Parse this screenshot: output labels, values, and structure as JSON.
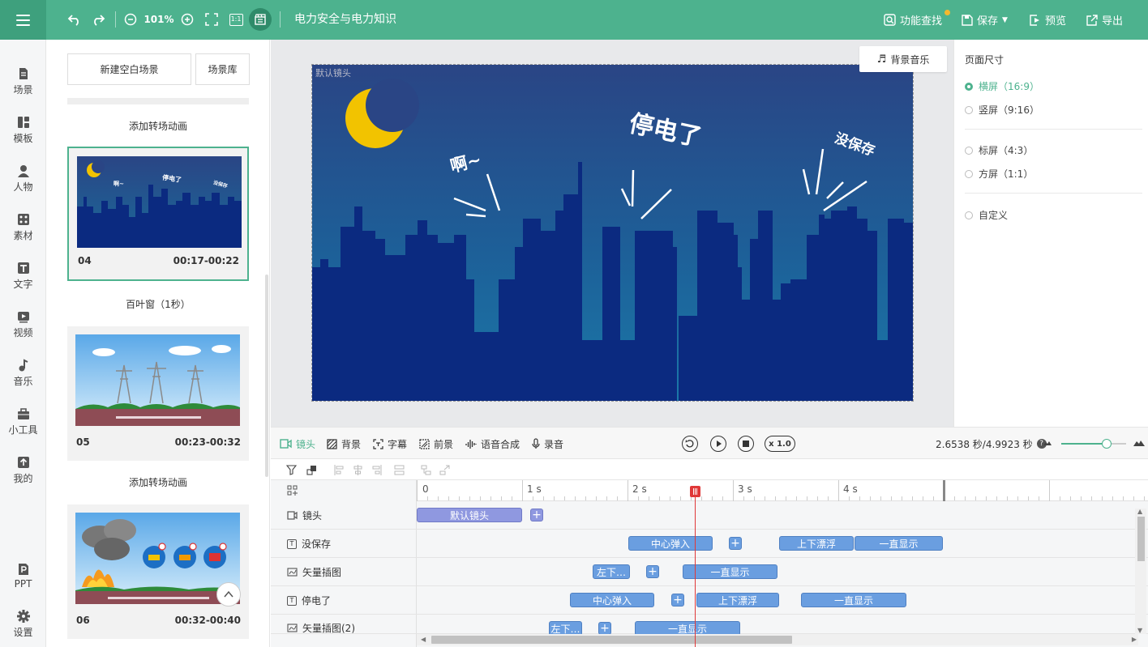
{
  "header": {
    "title": "电力安全与电力知识",
    "zoom": "101%",
    "ratio_btn": "1:1",
    "find_label": "功能查找",
    "save_label": "保存",
    "preview_label": "预览",
    "export_label": "导出"
  },
  "leftnav": {
    "items": [
      {
        "label": "场景"
      },
      {
        "label": "模板"
      },
      {
        "label": "人物"
      },
      {
        "label": "素材"
      },
      {
        "label": "文字"
      },
      {
        "label": "视频"
      },
      {
        "label": "音乐"
      },
      {
        "label": "小工具"
      },
      {
        "label": "我的"
      },
      {
        "label": "PPT"
      },
      {
        "label": "设置"
      }
    ]
  },
  "scenes": {
    "new_blank": "新建空白场景",
    "library": "场景库",
    "transitions": [
      "添加转场动画",
      "百叶窗（1秒）",
      "添加转场动画"
    ],
    "cards": [
      {
        "num": "04",
        "time": "00:17-00:22"
      },
      {
        "num": "05",
        "time": "00:23-00:32"
      },
      {
        "num": "06",
        "time": "00:32-00:40"
      }
    ]
  },
  "stage": {
    "default_lens": "默认镜头",
    "bgm_label": "背景音乐",
    "text_a": "啊~",
    "text_b": "停电了",
    "text_c": "没保存"
  },
  "page_size": {
    "heading": "页面尺寸",
    "options": [
      {
        "label": "横屏（16:9）",
        "selected": true
      },
      {
        "label": "竖屏（9:16）",
        "selected": false
      },
      {
        "label": "标屏（4:3）",
        "selected": false
      },
      {
        "label": "方屏（1:1）",
        "selected": false
      },
      {
        "label": "自定义",
        "selected": false
      }
    ]
  },
  "toolbar": {
    "tabs": [
      "镜头",
      "背景",
      "字幕",
      "前景",
      "语音合成",
      "录音"
    ],
    "speed": "x 1.0",
    "time": "2.6538 秒/4.9923 秒",
    "zoom_fraction": 0.7
  },
  "timeline": {
    "ruler": [
      "0",
      "1 s",
      "2 s",
      "3 s",
      "4 s"
    ],
    "tracks": [
      {
        "name": "镜头",
        "clips": [
          "默认镜头"
        ]
      },
      {
        "name": "没保存",
        "clips": [
          "中心弹入",
          "上下漂浮",
          "一直显示"
        ]
      },
      {
        "name": "矢量插图",
        "clips": [
          "左下…",
          "一直显示"
        ]
      },
      {
        "name": "停电了",
        "clips": [
          "中心弹入",
          "上下漂浮",
          "一直显示"
        ]
      },
      {
        "name": "矢量插图(2)",
        "clips": [
          "左下…",
          "一直显示"
        ]
      }
    ]
  },
  "colors": {
    "brand": "#4db28e",
    "clip": "#6a9ee0",
    "lens_clip": "#8f98e0",
    "playhead": "#e03838",
    "sky_top": "#2a4585",
    "city": "#0b2a80"
  }
}
